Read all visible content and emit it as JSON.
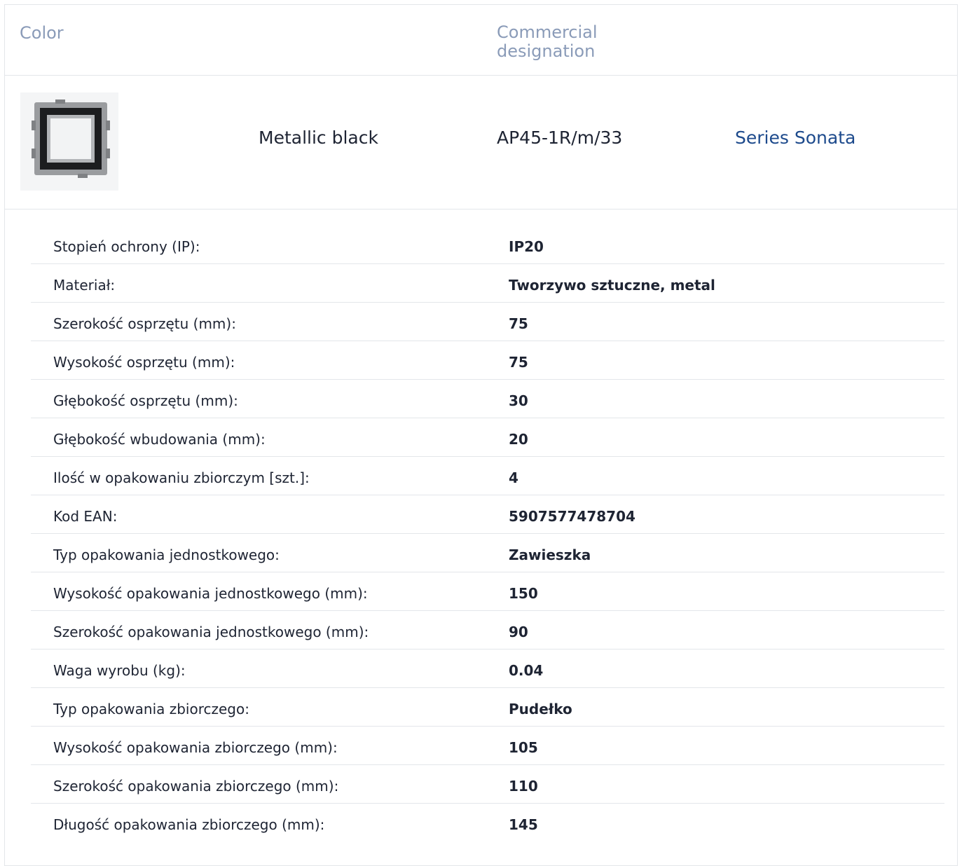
{
  "header": {
    "color_label": "Color",
    "commercial_label": "Commercial designation"
  },
  "product": {
    "color": "Metallic black",
    "code": "AP45-1R/m/33",
    "series_link": "Series Sonata",
    "thumbnail_icon": "frame-adapter-icon"
  },
  "specs": [
    {
      "label": "Stopień ochrony (IP):",
      "value": "IP20"
    },
    {
      "label": "Materiał:",
      "value": "Tworzywo sztuczne, metal"
    },
    {
      "label": "Szerokość osprzętu (mm):",
      "value": "75"
    },
    {
      "label": "Wysokość osprzętu (mm):",
      "value": "75"
    },
    {
      "label": "Głębokość osprzętu (mm):",
      "value": "30"
    },
    {
      "label": "Głębokość wbudowania (mm):",
      "value": "20"
    },
    {
      "label": "Ilość w opakowaniu zbiorczym [szt.]:",
      "value": "4"
    },
    {
      "label": "Kod EAN:",
      "value": "5907577478704"
    },
    {
      "label": "Typ opakowania jednostkowego:",
      "value": "Zawieszka"
    },
    {
      "label": "Wysokość opakowania jednostkowego (mm):",
      "value": "150"
    },
    {
      "label": "Szerokość opakowania jednostkowego (mm):",
      "value": "90"
    },
    {
      "label": "Waga wyrobu (kg):",
      "value": "0.04"
    },
    {
      "label": "Typ opakowania zbiorczego:",
      "value": "Pudełko"
    },
    {
      "label": "Wysokość opakowania zbiorczego (mm):",
      "value": "105"
    },
    {
      "label": "Szerokość opakowania zbiorczego (mm):",
      "value": "110"
    },
    {
      "label": "Długość opakowania zbiorczego (mm):",
      "value": "145"
    }
  ],
  "colors": {
    "text": "#1e2433",
    "header_text": "#8a9bb8",
    "link": "#1d4a8c",
    "border": "#e3e6ea"
  }
}
